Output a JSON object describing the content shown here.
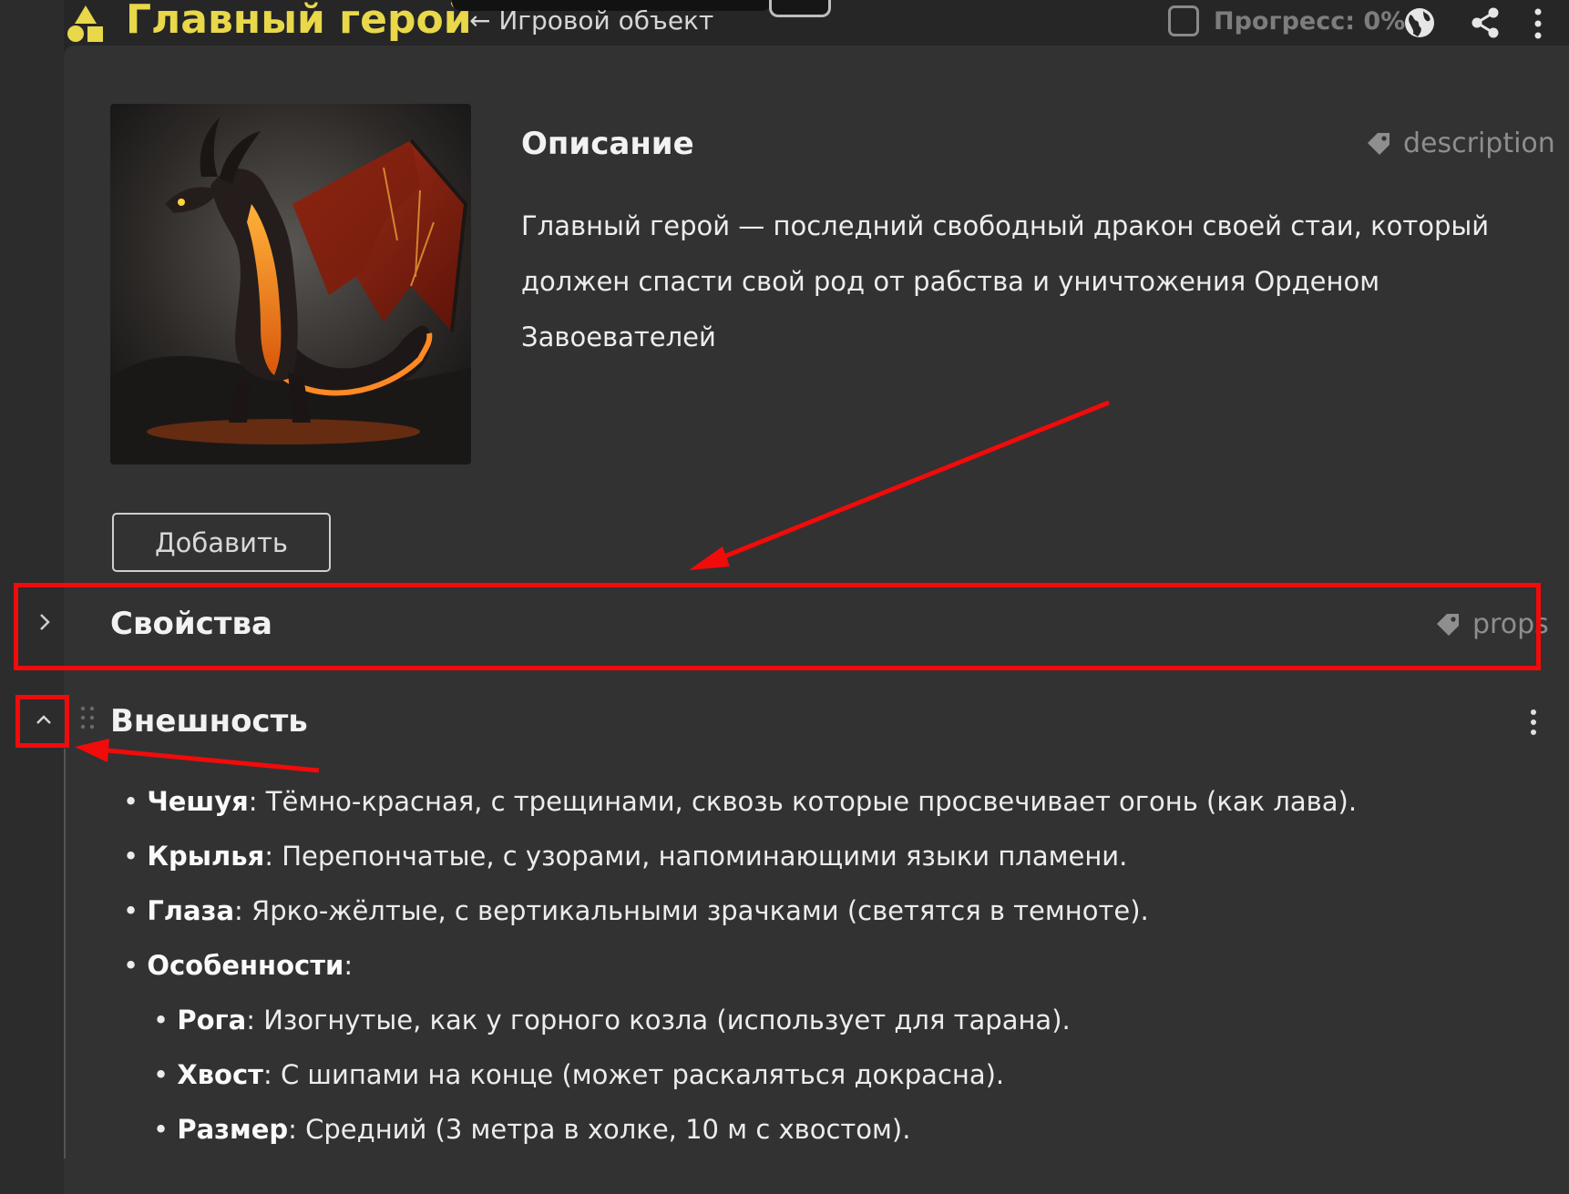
{
  "header": {
    "title": "Главный герой",
    "breadcrumb": "← Игровой объект",
    "progress_label": "Прогресс: 0%"
  },
  "description": {
    "title": "Описание",
    "tag": "description",
    "text": "Главный герой — последний свободный дракон своей стаи, который должен спасти свой род от рабства и уничтожения Орденом Завоевателей"
  },
  "add_button": {
    "label": "Добавить"
  },
  "properties": {
    "title": "Свойства",
    "tag": "props"
  },
  "appearance": {
    "title": "Внешность",
    "items": [
      {
        "bullet": "•",
        "key": "Чешуя",
        "sep": ":",
        "value": " Тёмно-красная, с трещинами, сквозь которые просвечивает огонь (как лава)."
      },
      {
        "bullet": "•",
        "key": "Крылья",
        "sep": ":",
        "value": " Перепончатые, с узорами, напоминающими языки пламени."
      },
      {
        "bullet": "•",
        "key": "Глаза",
        "sep": ":",
        "value": " Ярко-жёлтые, с вертикальными зрачками (светятся в темноте)."
      },
      {
        "bullet": "•",
        "key": "Особенности",
        "sep": ":",
        "value": ""
      },
      {
        "bullet": "•",
        "key": "Рога",
        "sep": ":",
        "value": " Изогнутые, как у горного козла (использует для тарана)."
      },
      {
        "bullet": "•",
        "key": "Хвост",
        "sep": ":",
        "value": " С шипами на конце (может раскаляться докрасна)."
      },
      {
        "bullet": "•",
        "key": "Размер",
        "sep": ":",
        "value": " Средний (3 метра в холке, 10 м с хвостом)."
      }
    ]
  },
  "colors": {
    "title": "#e8d84a",
    "background": "#262626",
    "panel": "#323232",
    "annotation": "#f10b0b"
  },
  "icons": {
    "shapes": "shapes-icon",
    "tag": "tag-icon",
    "globe": "globe-icon",
    "share": "share-icon",
    "more": "more-vertical-icon",
    "chevron_right": "chevron-right-icon",
    "chevron_up": "chevron-up-icon",
    "drag": "drag-handle-icon"
  }
}
